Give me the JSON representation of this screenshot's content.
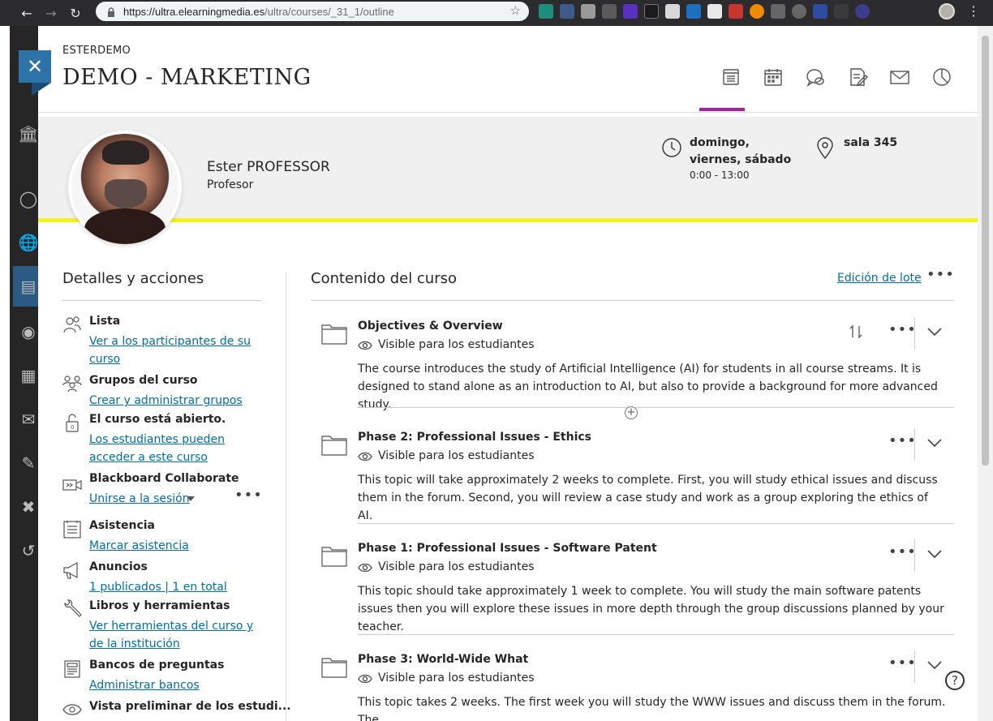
{
  "browser": {
    "url_host": "https://ultra.elearningmedia.es",
    "url_path": "/ultra/courses/_31_1/outline"
  },
  "course": {
    "org": "ESTERDEMO",
    "title": "DEMO - MARKETING"
  },
  "top_nav": [
    "course-content",
    "calendar",
    "discussions",
    "gradebook",
    "messages",
    "analytics"
  ],
  "instructor": {
    "name": "Ester PROFESSOR",
    "role": "Profesor"
  },
  "schedule": {
    "days": "domingo, viernes, sábado",
    "time": "0:00 - 13:00",
    "location": "sala 345"
  },
  "details": {
    "title": "Detalles y acciones",
    "items": [
      {
        "title": "Lista",
        "link": "Ver a los participantes de su curso",
        "icon": "roster-icon"
      },
      {
        "title": "Grupos del curso",
        "link": "Crear y administrar grupos",
        "icon": "groups-icon"
      },
      {
        "title": "El curso está abierto.",
        "link": "Los estudiantes pueden acceder a este curso",
        "icon": "unlock-icon"
      },
      {
        "title": "Blackboard Collaborate",
        "link": "Unirse a la sesión",
        "icon": "collaborate-icon"
      },
      {
        "title": "Asistencia",
        "link": "Marcar asistencia",
        "icon": "attendance-icon"
      },
      {
        "title": "Anuncios",
        "link": "1 publicados | 1 en total",
        "icon": "megaphone-icon"
      },
      {
        "title": "Libros y herramientas",
        "link": "Ver herramientas del curso y de la institución",
        "icon": "tools-icon"
      },
      {
        "title": "Bancos de preguntas",
        "link": "Administrar bancos",
        "icon": "question-bank-icon"
      },
      {
        "title": "Vista preliminar de los estudi...",
        "link": "",
        "icon": "preview-icon"
      }
    ]
  },
  "content": {
    "title": "Contenido del curso",
    "batch_edit": "Edición de lote",
    "items": [
      {
        "title": "Objectives & Overview",
        "visibility": "Visible para los estudiantes",
        "description": "The course introduces the study of Artificial Intelligence (AI) for students in all course streams. It is designed to stand alone as an introduction to AI, but also to provide a background for more advanced study."
      },
      {
        "title": "Phase 2: Professional Issues - Ethics",
        "visibility": "Visible para los estudiantes",
        "description": "This topic will take approximately 2 weeks to complete. First, you will study ethical issues and discuss them in the forum. Second, you will review a case study and work as a group exploring the ethics of AI."
      },
      {
        "title": "Phase 1: Professional Issues - Software Patent",
        "visibility": "Visible para los estudiantes",
        "description": "This topic should take approximately 1 week to complete. You will study the main software patents issues then you will explore these issues in more depth through the group discussions planned by your teacher."
      },
      {
        "title": "Phase 3: World-Wide What",
        "visibility": "Visible para los estudiantes",
        "description": "This topic takes 2 weeks. The first week you will study the WWW issues and discuss them in the forum. The"
      }
    ]
  },
  "colors": {
    "accent_purple": "#a81fa3",
    "banner_yellow": "#f4f21b",
    "link_blue": "#006dac",
    "close_blue": "#2e73a8"
  }
}
